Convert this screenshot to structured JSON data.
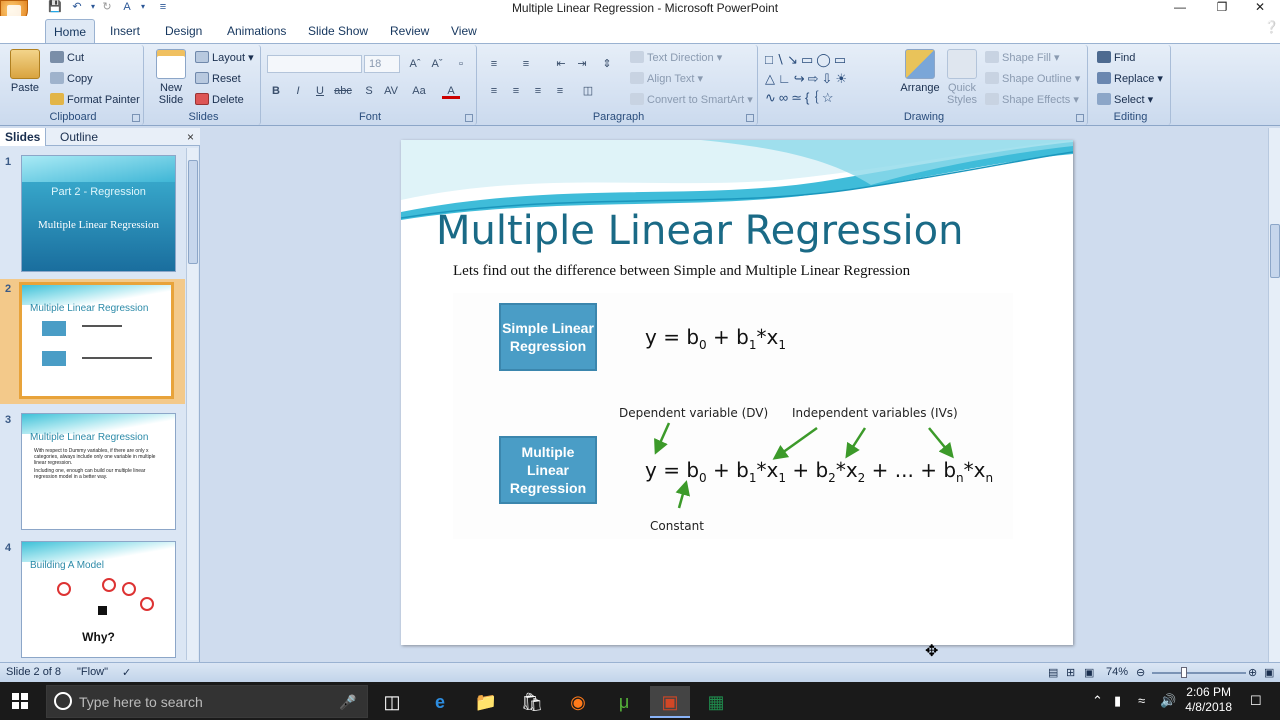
{
  "window": {
    "title": "Multiple Linear Regression - Microsoft PowerPoint"
  },
  "tabs": [
    "Home",
    "Insert",
    "Design",
    "Animations",
    "Slide Show",
    "Review",
    "View"
  ],
  "ribbon": {
    "clipboard": {
      "label": "Clipboard",
      "paste": "Paste",
      "cut": "Cut",
      "copy": "Copy",
      "format_painter": "Format Painter"
    },
    "slides": {
      "label": "Slides",
      "new_slide": "New Slide",
      "layout": "Layout",
      "reset": "Reset",
      "delete": "Delete"
    },
    "font": {
      "label": "Font",
      "size": "18"
    },
    "paragraph": {
      "label": "Paragraph",
      "text_direction": "Text Direction",
      "align_text": "Align Text",
      "convert": "Convert to SmartArt"
    },
    "drawing": {
      "label": "Drawing",
      "arrange": "Arrange",
      "quick_styles": "Quick Styles",
      "shape_fill": "Shape Fill",
      "shape_outline": "Shape Outline",
      "shape_effects": "Shape Effects"
    },
    "editing": {
      "label": "Editing",
      "find": "Find",
      "replace": "Replace",
      "select": "Select"
    }
  },
  "pane": {
    "tab_slides": "Slides",
    "tab_outline": "Outline",
    "thumbs": [
      {
        "num": "1",
        "title": "Part 2 - Regression",
        "subtitle": "Multiple Linear Regression"
      },
      {
        "num": "2",
        "title": "Multiple Linear Regression"
      },
      {
        "num": "3",
        "title": "Multiple Linear Regression",
        "bullets": [
          "With respect to Dummy variables, if there are only x categories, always include only one variable in multiple linear regression.",
          "Including one, enough can build our multiple linear regression model in a better way."
        ]
      },
      {
        "num": "4",
        "title": "Building A Model",
        "caption": "Why?"
      }
    ]
  },
  "slide": {
    "title": "Multiple Linear Regression",
    "subtitle": "Lets find out the difference between Simple and Multiple Linear Regression",
    "box_simple": "Simple Linear Regression",
    "box_multiple": "Multiple Linear Regression",
    "eq_simple": {
      "y": "y",
      "eq": "=",
      "b": "b",
      "s0": "0",
      "plus": "+",
      "b1": "b",
      "s1": "1",
      "x": "*x",
      "sx1": "1"
    },
    "eq_multi": {
      "y": "y",
      "eq": "=",
      "b": "b",
      "s0": "0",
      "plus1": "+",
      "b1": "b",
      "s1": "1",
      "x1": "*x",
      "sx1": "1",
      "plus2": "+",
      "b2": "b",
      "s2": "2",
      "x2": "*x",
      "sx2": "2",
      "plus3": "+",
      "dots": "...",
      "plus4": "+",
      "bn": "b",
      "sn": "n",
      "xn": "*x",
      "sxn": "n"
    },
    "label_dv": "Dependent variable (DV)",
    "label_iv": "Independent variables (IVs)",
    "label_const": "Constant",
    "arrow_color": "#3c9a2a"
  },
  "status": {
    "slide_info": "Slide 2 of 8",
    "theme": "\"Flow\"",
    "zoom": "74%"
  },
  "taskbar": {
    "search_placeholder": "Type here to search",
    "time": "2:06 PM",
    "date": "4/8/2018"
  }
}
